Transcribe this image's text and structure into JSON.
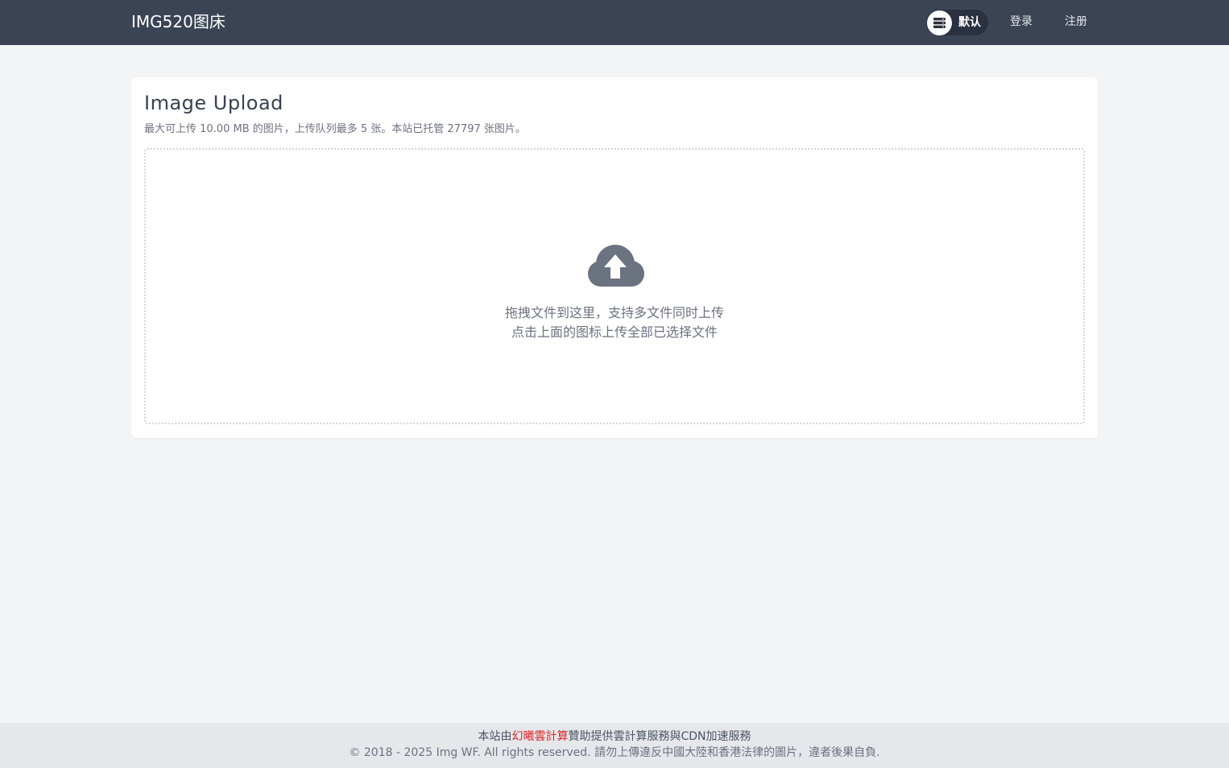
{
  "header": {
    "brand": "IMG520图床",
    "group_selector": {
      "label": "默认",
      "icon": "server-stack-icon"
    },
    "nav": {
      "login": "登录",
      "register": "注册"
    }
  },
  "upload_card": {
    "title": "Image Upload",
    "subtitle": "最大可上传 10.00 MB 的图片，上传队列最多 5 张。本站已托管 27797 张图片。",
    "dropzone": {
      "icon": "cloud-upload-icon",
      "line1": "拖拽文件到这里，支持多文件同时上传",
      "line2": "点击上面的图标上传全部已选择文件"
    }
  },
  "footer": {
    "prefix": "本站由",
    "sponsor": "幻曦雲計算",
    "suffix": "贊助提供雲計算服務與CDN加速服務",
    "copyright": "© 2018 - 2025 Img WF. All rights reserved. 請勿上傳違反中國大陸和香港法律的圖片，違者後果自負."
  },
  "colors": {
    "header_bg": "#3b4455",
    "page_bg": "#f3f4f6",
    "sponsor_link": "#dc2626",
    "cloud_icon": "#6b7280"
  }
}
